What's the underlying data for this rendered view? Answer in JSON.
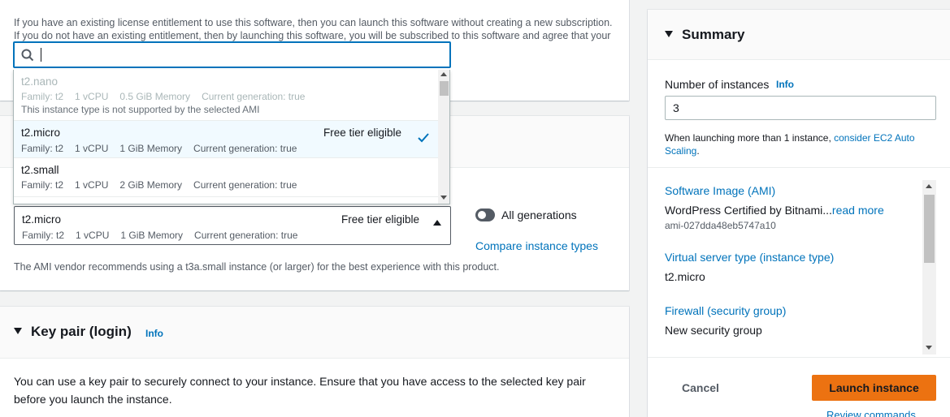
{
  "license": {
    "line1": "If you have an existing license entitlement to use this software, then you can launch this software without creating a new subscription.",
    "line2": "If you do not have an existing entitlement, then by launching this software, you will be subscribed to this software and agree that your"
  },
  "instance_type": {
    "selected": {
      "name": "t2.micro",
      "tag": "Free tier eligible",
      "family": "Family: t2",
      "vcpu": "1 vCPU",
      "memory": "1 GiB Memory",
      "generation": "Current generation: true"
    },
    "all_generations_label": "All generations",
    "compare_link": "Compare instance types",
    "recommendation": "The AMI vendor recommends using a t3a.small instance (or larger) for the best experience with this product."
  },
  "dropdown": {
    "search_value": "",
    "options": [
      {
        "name": "t2.nano",
        "family": "Family: t2",
        "vcpu": "1 vCPU",
        "memory": "0.5 GiB Memory",
        "generation": "Current generation: true",
        "note": "This instance type is not supported by the selected AMI",
        "disabled": true
      },
      {
        "name": "t2.micro",
        "tag": "Free tier eligible",
        "family": "Family: t2",
        "vcpu": "1 vCPU",
        "memory": "1 GiB Memory",
        "generation": "Current generation: true",
        "selected": true
      },
      {
        "name": "t2.small",
        "family": "Family: t2",
        "vcpu": "1 vCPU",
        "memory": "2 GiB Memory",
        "generation": "Current generation: true"
      }
    ]
  },
  "key_pair": {
    "title": "Key pair (login)",
    "info": "Info",
    "description_line1": "You can use a key pair to securely connect to your instance. Ensure that you have access to the selected key pair",
    "description_line2": "before you launch the instance."
  },
  "summary": {
    "title": "Summary",
    "instances_label": "Number of instances",
    "info": "Info",
    "instances_value": "3",
    "hint_prefix": "When launching more than 1 instance, ",
    "hint_link_1": "consider EC2 Auto",
    "hint_link_2": "Scaling",
    "hint_suffix": ".",
    "ami_label": "Software Image (AMI)",
    "ami_value": "WordPress Certified by Bitnami...",
    "ami_read_more": "read more",
    "ami_id": "ami-027dda48eb5747a10",
    "server_label": "Virtual server type (instance type)",
    "server_value": "t2.micro",
    "firewall_label": "Firewall (security group)",
    "firewall_value": "New security group",
    "cancel_label": "Cancel",
    "launch_label": "Launch instance",
    "review_label": "Review commands"
  },
  "colors": {
    "accent": "#0073bb",
    "launch_button": "#ec7211"
  }
}
